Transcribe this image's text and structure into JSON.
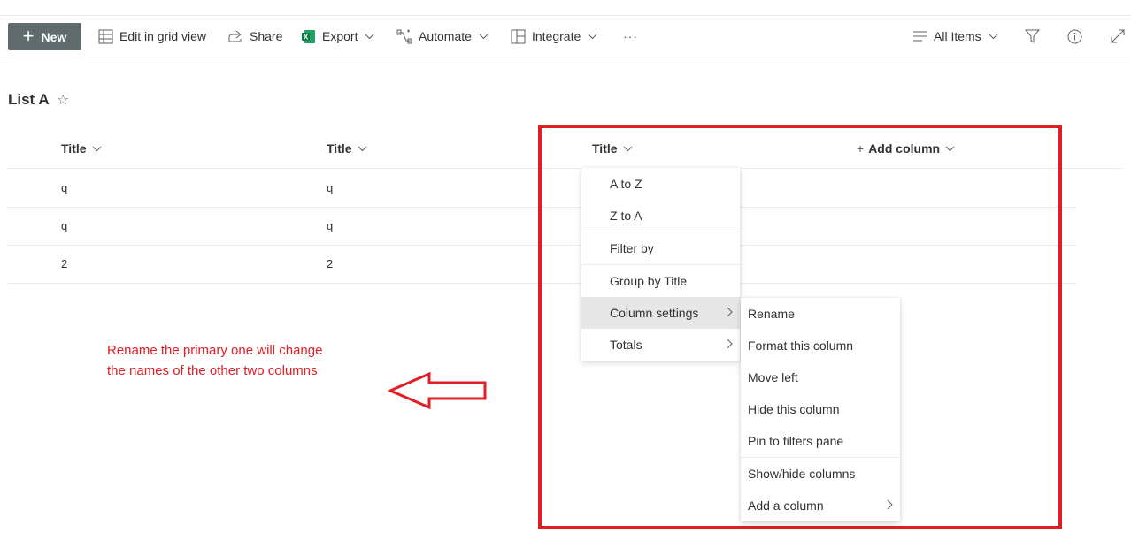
{
  "toolbar": {
    "new_label": "New",
    "edit_grid_label": "Edit in grid view",
    "share_label": "Share",
    "export_label": "Export",
    "automate_label": "Automate",
    "integrate_label": "Integrate",
    "more_label": "···",
    "view_label": "All Items"
  },
  "list": {
    "title": "List A",
    "columns": [
      "Title",
      "Title",
      "Title"
    ],
    "add_column_label": "Add column",
    "rows": [
      [
        "q",
        "q"
      ],
      [
        "q",
        "q"
      ],
      [
        "2",
        "2"
      ]
    ]
  },
  "context_menu": {
    "items": [
      "A to Z",
      "Z to A",
      "Filter by",
      "Group by Title",
      "Column settings",
      "Totals"
    ]
  },
  "column_settings_submenu": {
    "items": [
      "Rename",
      "Format this column",
      "Move left",
      "Hide this column",
      "Pin to filters pane",
      "Show/hide columns",
      "Add a column"
    ]
  },
  "annotation": {
    "line1": "Rename the primary one will change",
    "line2": "the names of the other two columns",
    "color": "#e11e26"
  },
  "colors": {
    "new_button_bg": "#5f6b6d",
    "excel_green": "#107c41",
    "annotation_red": "#e11e26"
  }
}
